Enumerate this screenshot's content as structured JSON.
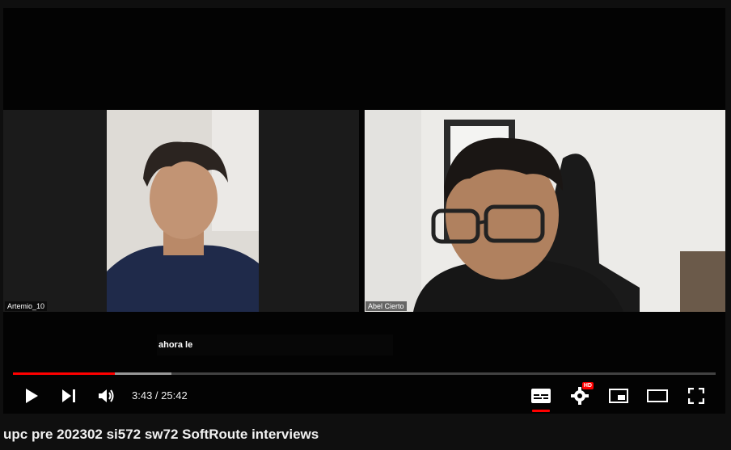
{
  "video": {
    "participants": [
      {
        "name": "Artemio_10"
      },
      {
        "name": "Abel Cierto"
      }
    ],
    "caption": "ahora le"
  },
  "player": {
    "time_display": "3:43 / 25:42",
    "progress_fraction": 0.145,
    "buffered_fraction": 0.225,
    "accent_color": "#ff0000",
    "icons": [
      "play-icon",
      "next-icon",
      "volume-icon",
      "subtitles-icon",
      "settings-icon",
      "miniplayer-icon",
      "theater-icon",
      "fullscreen-icon"
    ],
    "hd_badge": "HD"
  },
  "video_title": "upc pre 202302 si572 sw72 SoftRoute interviews"
}
